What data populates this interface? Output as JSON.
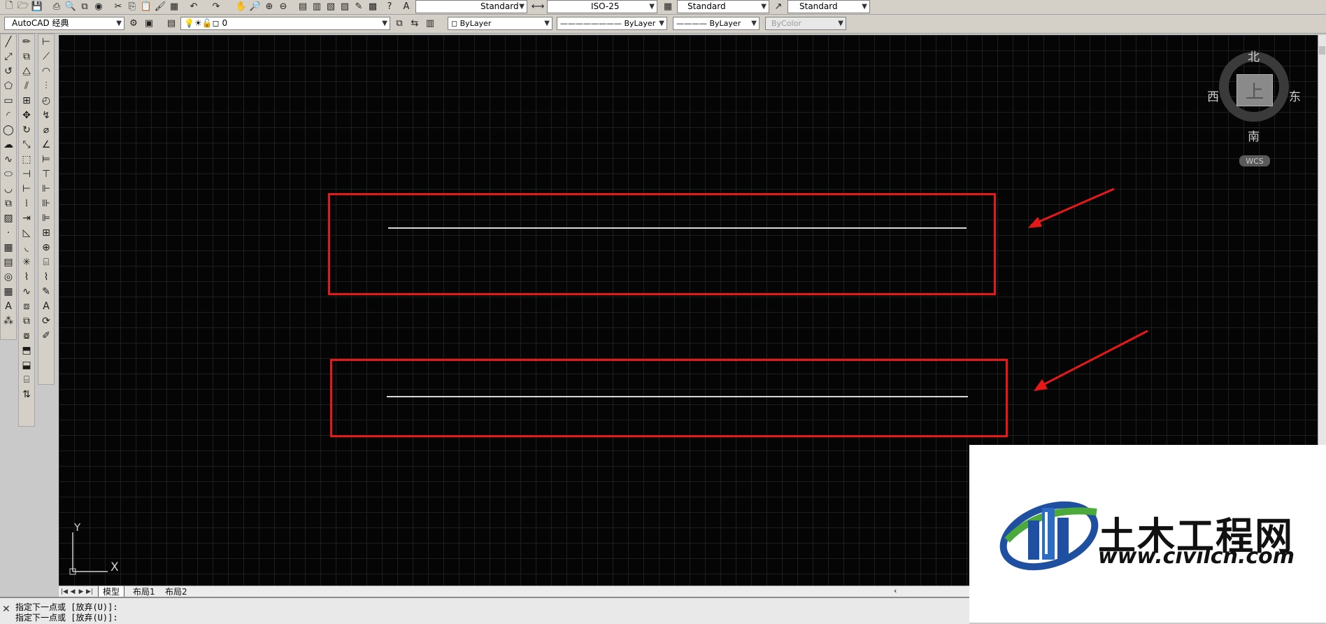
{
  "toolbar_top": {
    "text_style": "Standard",
    "dim_style": "ISO-25",
    "table_style": "Standard",
    "mleader_style": "Standard"
  },
  "toolbar_props": {
    "workspace": "AutoCAD 经典",
    "layer": "0",
    "color": "ByLayer",
    "linetype": "ByLayer",
    "lineweight": "ByLayer",
    "plotstyle": "ByColor"
  },
  "viewcube": {
    "north": "北",
    "south": "南",
    "east": "东",
    "west": "西",
    "face": "上",
    "wcs": "WCS"
  },
  "ucs": {
    "x": "X",
    "y": "Y"
  },
  "tabs": {
    "model": "模型",
    "layout1": "布局1",
    "layout2": "布局2"
  },
  "command": {
    "line1": "指定下一点或 [放弃(U)]:",
    "line2": "指定下一点或 [放弃(U)]:",
    "close": "✕"
  },
  "watermark": {
    "title": "土木工程网",
    "url": "www.civilcn.com"
  },
  "colors": {
    "canvas": "#050505",
    "highlight": "#e81818",
    "grid": "#1a1f1f"
  },
  "icons": {
    "top_toolbar": [
      "new-icon",
      "open-icon",
      "save-icon",
      "print-icon",
      "preview-icon",
      "publish-icon",
      "plot-3d-icon",
      "cut-icon",
      "copy-icon",
      "paste-icon",
      "match-icon",
      "block-editor-icon",
      "undo-icon",
      "redo-icon",
      "pan-icon",
      "zoom-realtime-icon",
      "zoom-window-icon",
      "zoom-previous-icon",
      "properties-icon",
      "design-center-icon",
      "tool-palettes-icon",
      "sheet-set-icon",
      "markup-icon",
      "calc-icon",
      "help-icon"
    ],
    "draw_tools": [
      "line-icon",
      "construction-line-icon",
      "polyline-icon",
      "polygon-icon",
      "rectangle-icon",
      "arc-icon",
      "circle-icon",
      "revcloud-icon",
      "spline-icon",
      "ellipse-icon",
      "ellipse-arc-icon",
      "insert-block-icon",
      "make-block-icon",
      "point-icon",
      "hatch-icon",
      "gradient-icon",
      "region-icon",
      "table-icon",
      "mtext-icon",
      "add-selected-icon"
    ]
  }
}
